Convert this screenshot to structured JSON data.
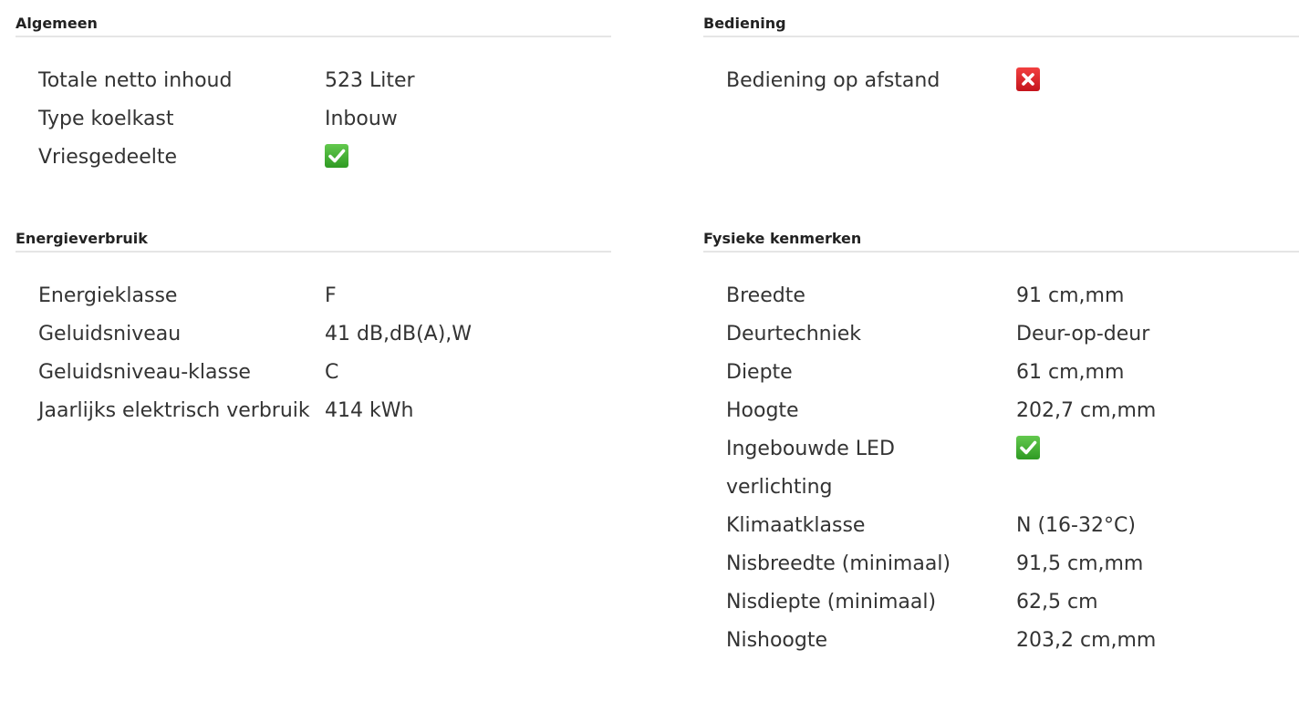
{
  "sections": {
    "algemeen": {
      "title": "Algemeen",
      "rows": [
        {
          "label": "Totale netto inhoud",
          "value": "523 Liter"
        },
        {
          "label": "Type koelkast",
          "value": "Inbouw"
        },
        {
          "label": "Vriesgedeelte",
          "icon": "check-icon"
        }
      ]
    },
    "bediening": {
      "title": "Bediening",
      "rows": [
        {
          "label": "Bediening op afstand",
          "icon": "cross-icon"
        }
      ]
    },
    "energieverbruik": {
      "title": "Energieverbruik",
      "rows": [
        {
          "label": "Energieklasse",
          "value": "F"
        },
        {
          "label": "Geluidsniveau",
          "value": "41 dB,dB(A),W"
        },
        {
          "label": "Geluidsniveau-klasse",
          "value": "C"
        },
        {
          "label": "Jaarlijks elektrisch verbruik",
          "value": "414 kWh"
        }
      ]
    },
    "fysieke_kenmerken": {
      "title": "Fysieke kenmerken",
      "rows": [
        {
          "label": "Breedte",
          "value": "91 cm,mm"
        },
        {
          "label": "Deurtechniek",
          "value": "Deur-op-deur"
        },
        {
          "label": "Diepte",
          "value": "61 cm,mm"
        },
        {
          "label": "Hoogte",
          "value": "202,7 cm,mm"
        },
        {
          "label": "Ingebouwde LED verlichting",
          "icon": "check-icon"
        },
        {
          "label": "Klimaatklasse",
          "value": "N (16-32°C)"
        },
        {
          "label": "Nisbreedte (minimaal)",
          "value": "91,5 cm,mm"
        },
        {
          "label": "Nisdiepte (minimaal)",
          "value": "62,5 cm"
        },
        {
          "label": "Nishoogte",
          "value": "203,2 cm,mm"
        }
      ]
    }
  }
}
